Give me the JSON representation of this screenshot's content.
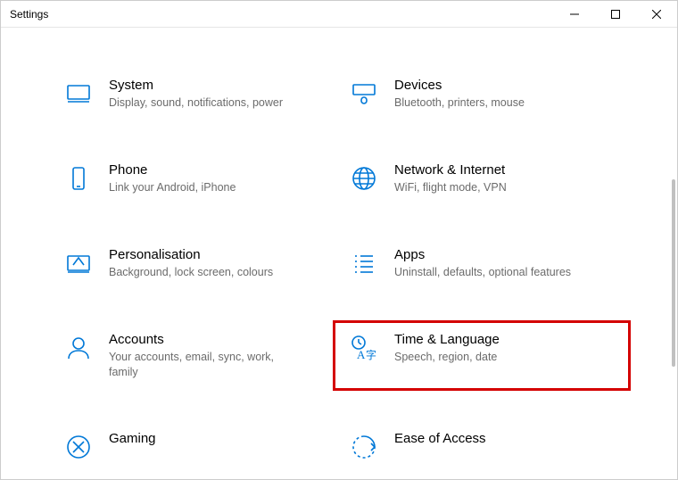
{
  "window": {
    "title": "Settings"
  },
  "categories": [
    {
      "key": "system",
      "title": "System",
      "desc": "Display, sound, notifications, power"
    },
    {
      "key": "devices",
      "title": "Devices",
      "desc": "Bluetooth, printers, mouse"
    },
    {
      "key": "phone",
      "title": "Phone",
      "desc": "Link your Android, iPhone"
    },
    {
      "key": "network",
      "title": "Network & Internet",
      "desc": "WiFi, flight mode, VPN"
    },
    {
      "key": "personalisation",
      "title": "Personalisation",
      "desc": "Background, lock screen, colours"
    },
    {
      "key": "apps",
      "title": "Apps",
      "desc": "Uninstall, defaults, optional features"
    },
    {
      "key": "accounts",
      "title": "Accounts",
      "desc": "Your accounts, email, sync, work, family"
    },
    {
      "key": "time-language",
      "title": "Time & Language",
      "desc": "Speech, region, date"
    },
    {
      "key": "gaming",
      "title": "Gaming",
      "desc": ""
    },
    {
      "key": "ease-of-access",
      "title": "Ease of Access",
      "desc": ""
    }
  ],
  "highlighted_key": "time-language"
}
